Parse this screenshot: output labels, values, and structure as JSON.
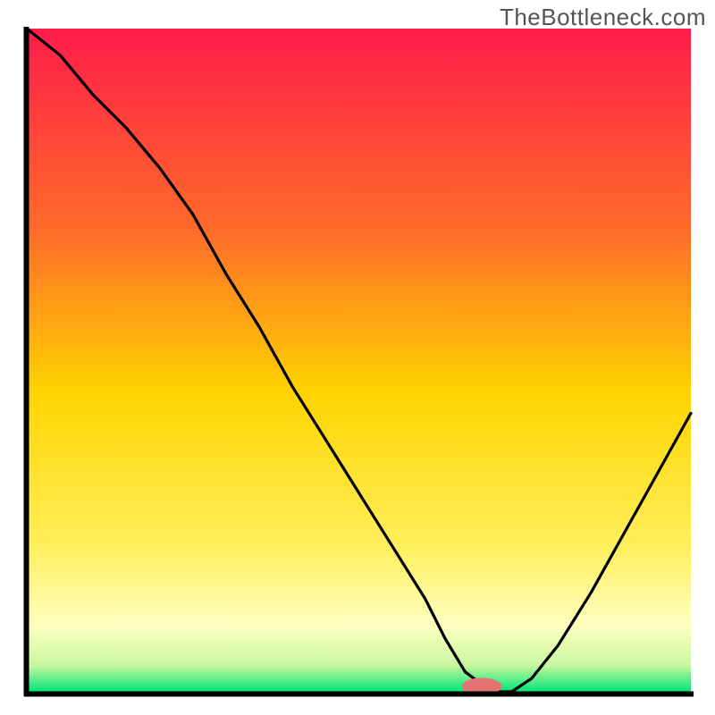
{
  "watermark": "TheBottleneck.com",
  "chart_data": {
    "type": "line",
    "title": "",
    "xlabel": "",
    "ylabel": "",
    "xlim": [
      0,
      100
    ],
    "ylim": [
      0,
      100
    ],
    "x": [
      0,
      5,
      10,
      15,
      20,
      25,
      30,
      35,
      40,
      45,
      50,
      55,
      60,
      63,
      66,
      70,
      73,
      76,
      80,
      85,
      90,
      95,
      100
    ],
    "values": [
      100,
      96,
      90,
      85,
      79,
      72,
      63,
      55,
      46,
      38,
      30,
      22,
      14,
      8,
      3,
      0,
      0,
      2,
      7,
      15,
      24,
      33,
      42
    ],
    "colors": {
      "gradient_top": "#FF1C4A",
      "gradient_mid_upper": "#FF8A2A",
      "gradient_mid": "#FFD400",
      "gradient_mid_lower": "#FFFF99",
      "gradient_bottom": "#00E676",
      "curve": "#000000",
      "axis": "#000000",
      "marker": "#E67373"
    },
    "marker": {
      "x": 68.5,
      "y": 0,
      "rx": 3,
      "ry": 1.3
    },
    "axes_visible": false,
    "grid": false
  }
}
